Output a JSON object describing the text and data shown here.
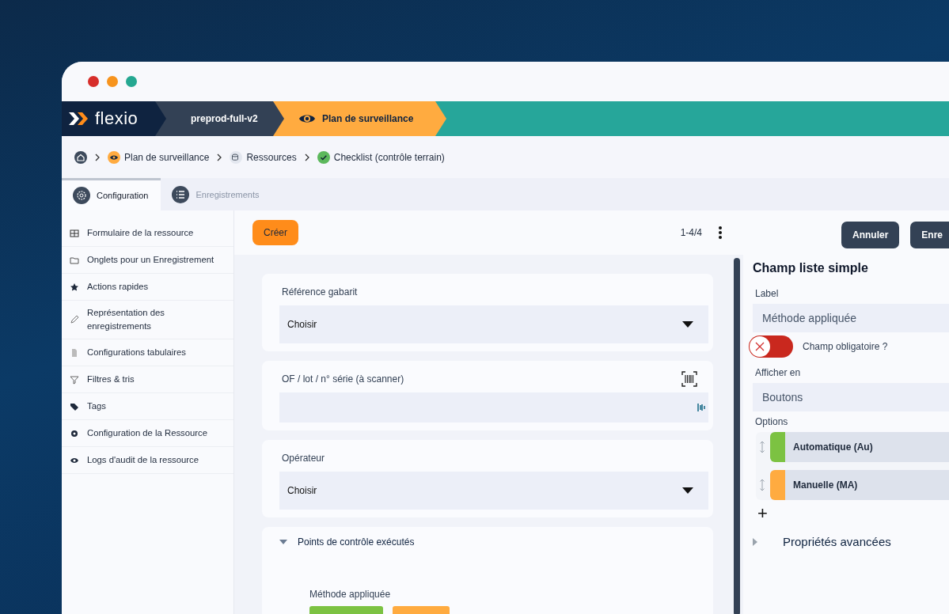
{
  "window": {
    "logo": "flexio"
  },
  "header": {
    "segments": [
      {
        "label": "preprod-full-v2",
        "kind": "env"
      },
      {
        "label": "Plan de surveillance",
        "kind": "module"
      }
    ]
  },
  "breadcrumb": [
    {
      "label": "Plan de surveillance",
      "kind": "eye"
    },
    {
      "label": "Ressources",
      "kind": "resources"
    },
    {
      "label": "Checklist (contrôle terrain)",
      "kind": "check"
    }
  ],
  "tabs": [
    {
      "label": "Configuration",
      "selected": true
    },
    {
      "label": "Enregistrements",
      "selected": false
    }
  ],
  "sidebar": {
    "items": [
      {
        "label": "Formulaire de la ressource"
      },
      {
        "label": "Onglets pour un Enregistrement"
      },
      {
        "label": "Actions rapides"
      },
      {
        "label": "Représentation des enregistrements"
      },
      {
        "label": "Configurations tabulaires"
      },
      {
        "label": "Filtres & tris"
      },
      {
        "label": "Tags"
      },
      {
        "label": "Configuration de la Ressource"
      },
      {
        "label": "Logs d'audit de la ressource"
      }
    ]
  },
  "form": {
    "create_button": "Créer",
    "pagination": "1-4/4",
    "fields": [
      {
        "label": "Référence gabarit",
        "kind": "select",
        "value": "Choisir"
      },
      {
        "label": "OF / lot / n° série (à scanner)",
        "kind": "scan"
      },
      {
        "label": "Opérateur",
        "kind": "select",
        "value": "Choisir"
      }
    ],
    "section": {
      "title": "Points de contrôle exécutés",
      "expanded": true,
      "field_label": "Méthode appliquée",
      "choices": [
        {
          "color": "#7cc242"
        },
        {
          "color": "#ffab40"
        }
      ]
    }
  },
  "editor": {
    "buttons": [
      "Annuler",
      "Enre"
    ],
    "title": "Champ liste simple",
    "label_caption": "Label",
    "label_value": "Méthode appliquée",
    "required": {
      "label": "Champ obligatoire ?",
      "on": false
    },
    "display_caption": "Afficher en",
    "display_value": "Boutons",
    "options_caption": "Options",
    "options": [
      {
        "label": "Automatique (Au)",
        "color": "#7cc242"
      },
      {
        "label": "Manuelle (MA)",
        "color": "#ffab40"
      }
    ],
    "add_symbol": "+",
    "advanced": {
      "title": "Propriétés avancées",
      "expanded": false
    }
  }
}
